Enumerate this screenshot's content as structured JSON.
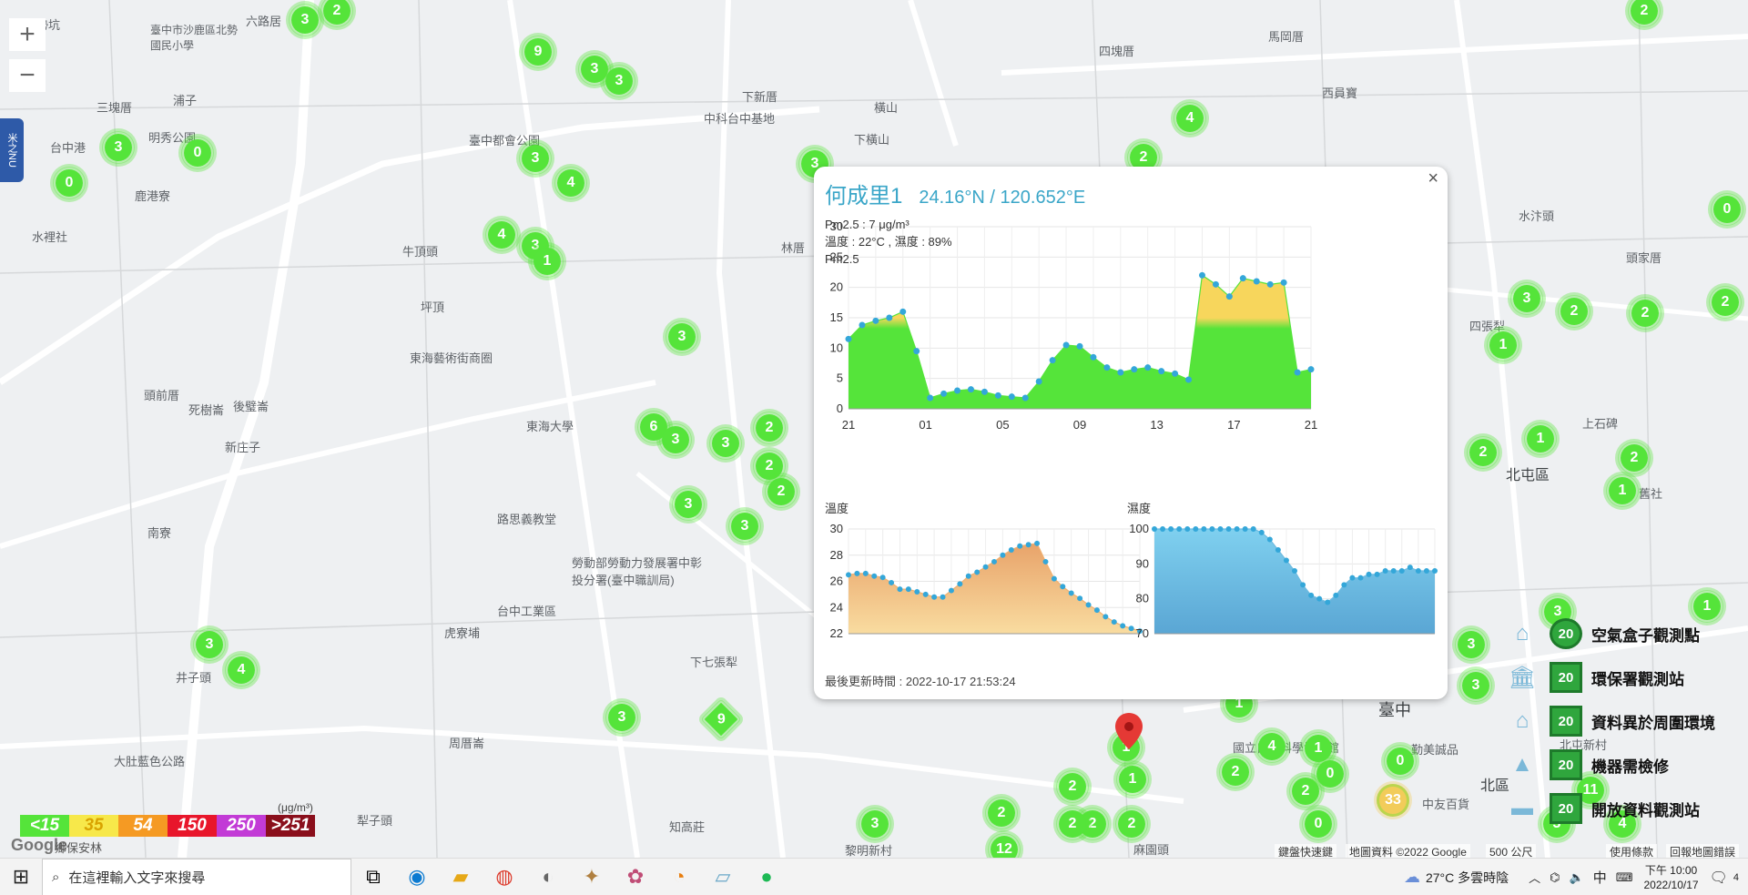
{
  "map": {
    "places": [
      {
        "text": "勢坑",
        "big": false
      },
      {
        "text": "六路居",
        "big": false
      },
      {
        "text": "臺中市沙鹿區北勢國民小學",
        "big": false
      },
      {
        "text": "三塊厝",
        "big": false
      },
      {
        "text": "浦子",
        "big": false
      },
      {
        "text": "明秀公園",
        "big": false
      },
      {
        "text": "台中港",
        "big": false
      },
      {
        "text": "鹿港寮",
        "big": false
      },
      {
        "text": "水裡社",
        "big": false
      },
      {
        "text": "臺中都會公園",
        "big": false
      },
      {
        "text": "牛頂頭",
        "big": false
      },
      {
        "text": "坪頂",
        "big": false
      },
      {
        "text": "東海藝術街商圈",
        "big": false
      },
      {
        "text": "頭前厝",
        "big": false
      },
      {
        "text": "死樹崙",
        "big": false
      },
      {
        "text": "後璧崙",
        "big": false
      },
      {
        "text": "新庄子",
        "big": false
      },
      {
        "text": "東海大學",
        "big": false
      },
      {
        "text": "路思義教堂",
        "big": false
      },
      {
        "text": "南寮",
        "big": false
      },
      {
        "text": "勞動部勞動力發展署中彰投分署(臺中職訓局)",
        "big": false
      },
      {
        "text": "台中工業區",
        "big": false
      },
      {
        "text": "虎寮埔",
        "big": false
      },
      {
        "text": "井子頭",
        "big": false
      },
      {
        "text": "下七張犁",
        "big": false
      },
      {
        "text": "大肚藍色公路",
        "big": false
      },
      {
        "text": "周厝崙",
        "big": false
      },
      {
        "text": "知高莊",
        "big": false
      },
      {
        "text": "犁子頭",
        "big": false
      },
      {
        "text": "黎明新村",
        "big": false
      },
      {
        "text": "麻園頭",
        "big": false
      },
      {
        "text": "中科台中基地",
        "big": false
      },
      {
        "text": "下新厝",
        "big": false
      },
      {
        "text": "橫山",
        "big": false
      },
      {
        "text": "下橫山",
        "big": false
      },
      {
        "text": "四塊厝",
        "big": false
      },
      {
        "text": "馬岡厝",
        "big": false
      },
      {
        "text": "西員寶",
        "big": false
      },
      {
        "text": "林厝",
        "big": false
      },
      {
        "text": "水汴頭",
        "big": false
      },
      {
        "text": "頭家厝",
        "big": false
      },
      {
        "text": "四張犁",
        "big": false
      },
      {
        "text": "北屯區",
        "big": true
      },
      {
        "text": "舊社",
        "big": false
      },
      {
        "text": "臺中",
        "big": true
      },
      {
        "text": "北區",
        "big": true
      },
      {
        "text": "國立自然科學博物館",
        "big": false
      },
      {
        "text": "勤美誠品",
        "big": false
      },
      {
        "text": "中友百貨",
        "big": false
      },
      {
        "text": "北屯新村",
        "big": false
      },
      {
        "text": "上石碑",
        "big": false
      }
    ],
    "markers": [
      "3",
      "2",
      "9",
      "3",
      "3",
      "3",
      "3",
      "0",
      "0",
      "3",
      "4",
      "4",
      "3",
      "1",
      "3",
      "6",
      "3",
      "3",
      "2",
      "2",
      "2",
      "3",
      "3",
      "3",
      "4",
      "3",
      "9",
      "1",
      "3",
      "2",
      "2",
      "4",
      "2",
      "4",
      "2",
      "2",
      "0",
      "1",
      "1",
      "1",
      "2",
      "2",
      "2",
      "0",
      "2",
      "3",
      "2",
      "2",
      "2",
      "1",
      "1",
      "1",
      "0",
      "3",
      "3",
      "1",
      "2",
      "33",
      "0",
      "2",
      "11",
      "3",
      "4",
      "12",
      "3"
    ],
    "zoom_in": "+",
    "zoom_out": "−",
    "side_tab": "米之NU"
  },
  "popup": {
    "title": "何成里1",
    "coordinates": "24.16°N / 120.652°E",
    "pm25_line": "Pm2.5 : 7 μg/m³",
    "temp_humidity_line": "溫度 : 22°C , 濕度 : 89%",
    "pm_chart_title": "Pm2.5",
    "close": "×",
    "updated": "最後更新時間 : 2022-10-17 21:53:24",
    "temp_title": "溫度",
    "humidity_title": "濕度"
  },
  "chart_data": [
    {
      "type": "area",
      "title": "Pm2.5",
      "x": [
        "21",
        "",
        "",
        "",
        "",
        "",
        "01",
        "",
        "",
        "",
        "",
        "",
        "05",
        "",
        "",
        "",
        "",
        "",
        "09",
        "",
        "",
        "",
        "",
        "",
        "13",
        "",
        "",
        "",
        "",
        "",
        "17",
        "",
        "",
        "",
        "",
        "",
        "21"
      ],
      "xticks": [
        "21",
        "01",
        "05",
        "09",
        "13",
        "17",
        "21"
      ],
      "values": [
        11.5,
        13.8,
        14.5,
        15.0,
        16.0,
        9.5,
        1.8,
        2.5,
        3.0,
        3.2,
        2.8,
        2.2,
        2.0,
        1.8,
        4.5,
        8.0,
        10.5,
        10.3,
        8.5,
        6.8,
        6.0,
        6.5,
        6.8,
        6.2,
        5.8,
        4.8,
        22,
        20.5,
        18.5,
        21.5,
        21.0,
        20.5,
        20.8,
        6.0,
        6.5
      ],
      "ylim": [
        0,
        30
      ],
      "yticks": [
        0,
        5,
        10,
        15,
        20,
        25,
        30
      ],
      "colors": {
        "low": "#55e43a",
        "mid": "#f7d65c"
      }
    },
    {
      "type": "area",
      "title": "溫度",
      "values": [
        26.5,
        26.6,
        26.6,
        26.4,
        26.3,
        25.9,
        25.4,
        25.4,
        25.2,
        25.0,
        24.8,
        24.8,
        25.3,
        25.8,
        26.4,
        26.7,
        27.1,
        27.5,
        28.0,
        28.4,
        28.7,
        28.8,
        28.9,
        27.5,
        26.2,
        25.6,
        25.1,
        24.7,
        24.2,
        23.8,
        23.3,
        22.9,
        22.6,
        22.4,
        22.2
      ],
      "ylim": [
        22,
        30
      ],
      "yticks": [
        22,
        24,
        26,
        28,
        30
      ],
      "color": "#f0c488"
    },
    {
      "type": "area",
      "title": "濕度",
      "values": [
        100,
        100,
        100,
        100,
        100,
        100,
        100,
        100,
        100,
        100,
        100,
        100,
        100,
        99,
        97,
        94,
        91,
        88,
        84,
        81,
        80,
        79,
        81,
        84,
        86,
        86,
        87,
        87,
        88,
        88,
        88,
        89,
        88,
        88,
        88
      ],
      "ylim": [
        70,
        100
      ],
      "yticks": [
        70,
        80,
        90,
        100
      ],
      "color": "#67bde6"
    }
  ],
  "legend_scale": {
    "unit": "(μg/m³)",
    "items": [
      {
        "label": "<15",
        "color": "#55e43a"
      },
      {
        "label": "35",
        "color": "#f7e84a"
      },
      {
        "label": "54",
        "color": "#f59a23"
      },
      {
        "label": "150",
        "color": "#e8162b"
      },
      {
        "label": "250",
        "color": "#c23bd6"
      },
      {
        "label": ">251",
        "color": "#8a0f1c"
      }
    ]
  },
  "legend_types": [
    {
      "icon": "home-icon",
      "num": "20",
      "label": "空氣盒子觀測點"
    },
    {
      "icon": "government-icon",
      "num": "20",
      "label": "環保署觀測站"
    },
    {
      "icon": "school-icon",
      "num": "20",
      "label": "資料異於周圍環境"
    },
    {
      "icon": "tower-icon",
      "num": "20",
      "label": "機器需檢修"
    },
    {
      "icon": "book-icon",
      "num": "20",
      "label": "開放資料觀測站"
    }
  ],
  "attribution": {
    "google": "Google",
    "lin": "鄉保安林",
    "shortcuts": "鍵盤快速鍵",
    "mapdata": "地圖資料 ©2022 Google",
    "scale": "500 公尺",
    "terms": "使用條款",
    "report": "回報地圖錯誤"
  },
  "taskbar": {
    "search_placeholder": "在這裡輸入文字來搜尋",
    "weather": "27°C  多雲時陰",
    "ime": "中",
    "time": "下午 10:00",
    "date": "2022/10/17",
    "notifications": "4"
  }
}
